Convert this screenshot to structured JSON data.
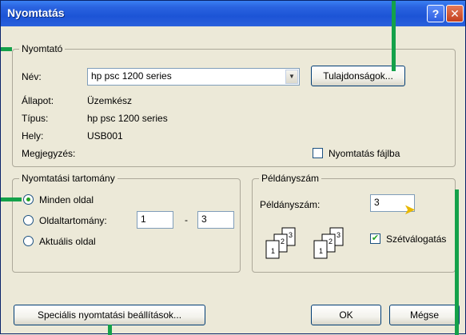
{
  "window": {
    "title": "Nyomtatás",
    "help_label": "?",
    "close_label": "✕"
  },
  "printer": {
    "group_label": "Nyomtató",
    "name_label": "Név:",
    "name_value": "hp psc 1200 series",
    "properties_button": "Tulajdonságok...",
    "status_label": "Állapot:",
    "status_value": "Üzemkész",
    "type_label": "Típus:",
    "type_value": "hp psc 1200 series",
    "location_label": "Hely:",
    "location_value": "USB001",
    "comment_label": "Megjegyzés:",
    "print_to_file_label": "Nyomtatás fájlba",
    "print_to_file_checked": false
  },
  "range": {
    "group_label": "Nyomtatási tartomány",
    "all_label": "Minden oldal",
    "pages_label": "Oldaltartomány:",
    "from_value": "1",
    "dash": "-",
    "to_value": "3",
    "current_label": "Aktuális oldal",
    "selected": "all"
  },
  "copies": {
    "group_label": "Példányszám",
    "count_label": "Példányszám:",
    "count_value": "3",
    "collate_label": "Szétválogatás",
    "collate_checked": true,
    "page_numbers": [
      "1",
      "2",
      "3"
    ]
  },
  "footer": {
    "special_settings_button": "Speciális nyomtatási beállítások...",
    "ok_button": "OK",
    "cancel_button": "Mégse"
  },
  "colors": {
    "titlebar": "#1c54d6",
    "dialog_bg": "#ece9d8",
    "annotation_pointer": "#14a14a"
  }
}
